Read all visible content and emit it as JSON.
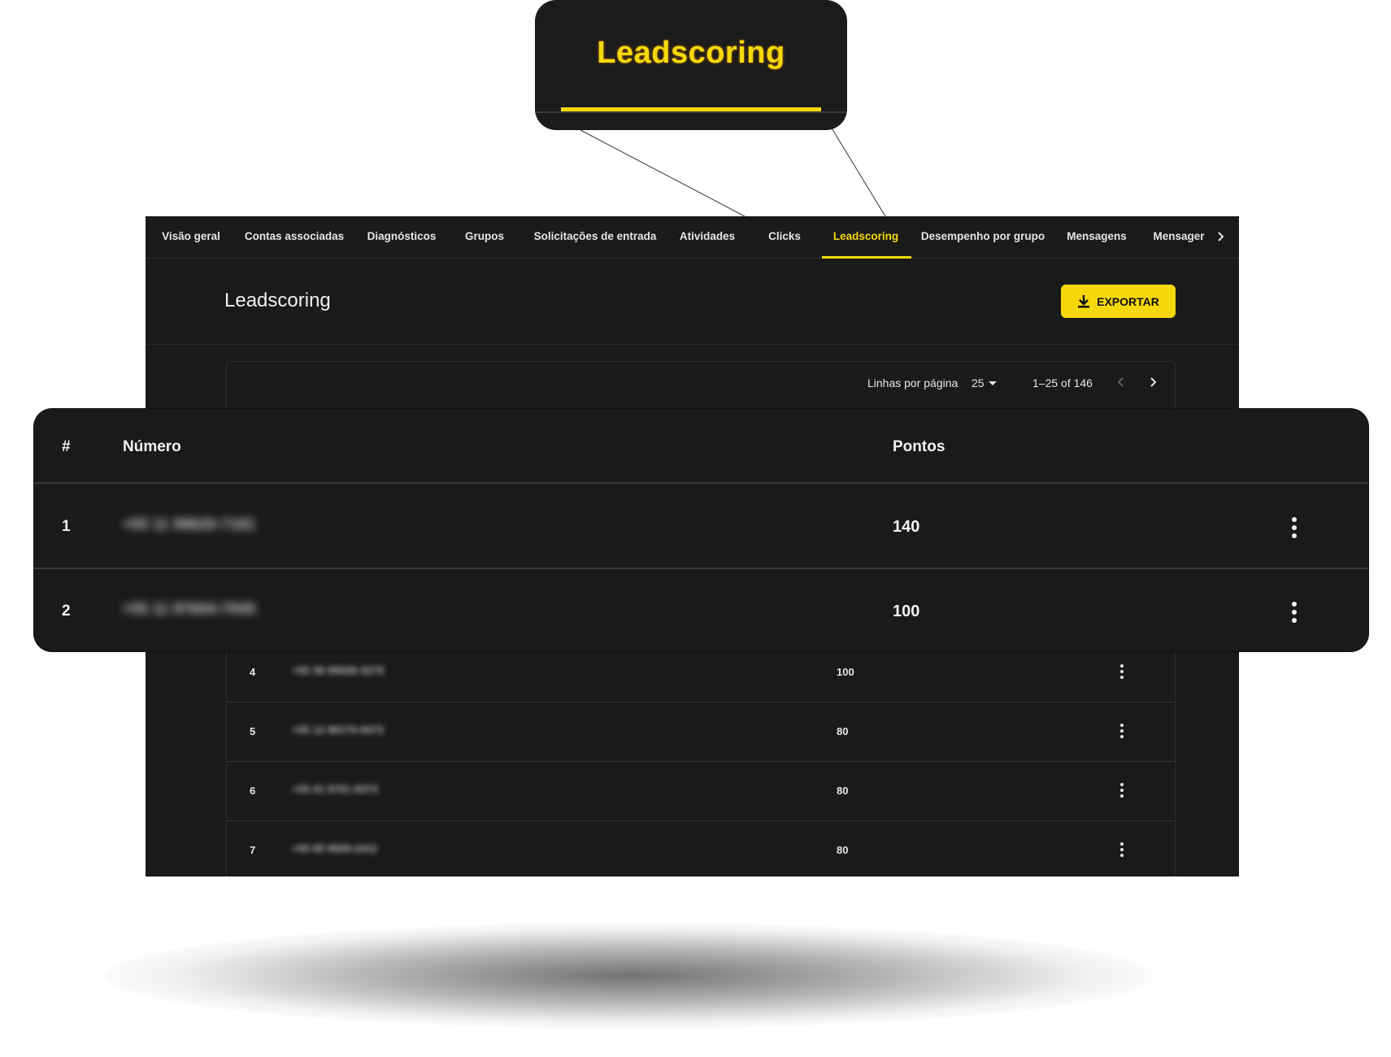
{
  "zoom_callout": {
    "label": "Leadscoring"
  },
  "tabs": [
    {
      "label": "Visão geral"
    },
    {
      "label": "Contas associadas"
    },
    {
      "label": "Diagnósticos"
    },
    {
      "label": "Grupos"
    },
    {
      "label": "Solicitações de entrada"
    },
    {
      "label": "Atividades"
    },
    {
      "label": "Clicks"
    },
    {
      "label": "Leadscoring",
      "active": true
    },
    {
      "label": "Desempenho por grupo"
    },
    {
      "label": "Mensagens"
    },
    {
      "label": "Mensager"
    }
  ],
  "header": {
    "title": "Leadscoring",
    "export_label": "EXPORTAR"
  },
  "pagination": {
    "rows_per_page_label": "Linhas por página",
    "rows_per_page_value": "25",
    "range": "1–25 of 146"
  },
  "table": {
    "columns": [
      "#",
      "Número",
      "Pontos"
    ],
    "rows": [
      {
        "index": "1",
        "numero": "+55 11 99620-7181",
        "pontos": "140"
      },
      {
        "index": "2",
        "numero": "+55 11 97604-7945",
        "pontos": "100"
      },
      {
        "index": "4",
        "numero": "+55 38 99938-3279",
        "pontos": "100"
      },
      {
        "index": "5",
        "numero": "+55 12 98176-6073",
        "pontos": "80"
      },
      {
        "index": "6",
        "numero": "+55 41 9751-9373",
        "pontos": "80"
      },
      {
        "index": "7",
        "numero": "+55 85 9609-2411",
        "pontos": "80"
      }
    ]
  },
  "colors": {
    "accent": "#f4d90a",
    "background": "#1a1a1a"
  }
}
